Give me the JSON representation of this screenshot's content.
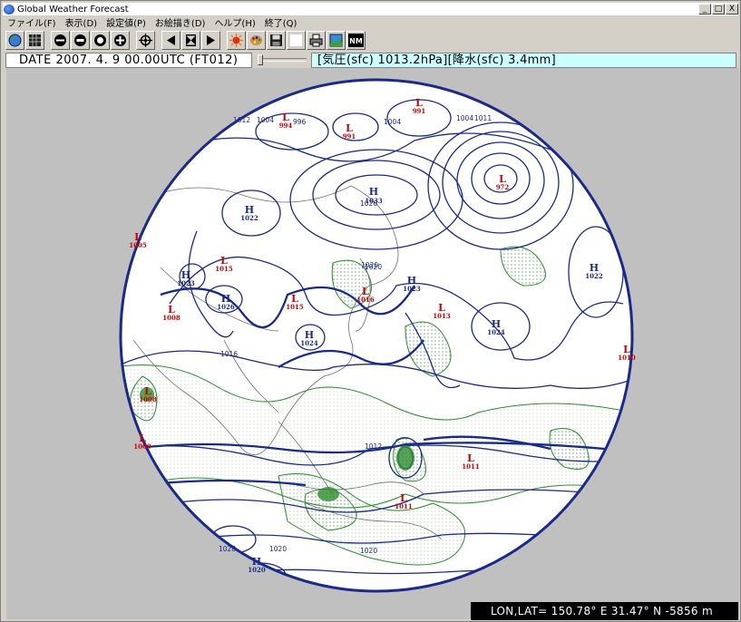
{
  "window": {
    "title": "Global Weather Forecast",
    "controls": {
      "minimize": "_",
      "maximize": "□",
      "close": "X"
    }
  },
  "menu": {
    "items": [
      "ファイル(F)",
      "表示(D)",
      "設定値(P)",
      "お絵描き(D)",
      "ヘルプ(H)",
      "終了(Q)"
    ]
  },
  "toolbar": {
    "buttons": [
      {
        "icon": "globe-icon"
      },
      {
        "icon": "grid-icon"
      },
      {
        "icon": "zoom-out-icon",
        "glyph": "−"
      },
      {
        "icon": "zoom-minus-icon",
        "glyph": "⊖"
      },
      {
        "icon": "zoom-plus-icon",
        "glyph": "⊕"
      },
      {
        "icon": "plus-icon",
        "glyph": "+"
      },
      {
        "icon": "center-icon",
        "glyph": "⌖"
      },
      {
        "icon": "step-back-icon",
        "glyph": "◀"
      },
      {
        "icon": "stop-icon",
        "glyph": "⧓"
      },
      {
        "icon": "step-forward-icon",
        "glyph": "▶"
      },
      {
        "icon": "sun-icon",
        "glyph": "☀"
      },
      {
        "icon": "palette-icon",
        "glyph": "◍"
      },
      {
        "icon": "save-icon",
        "glyph": "▣"
      },
      {
        "icon": "blank-icon",
        "glyph": ""
      },
      {
        "icon": "print-icon",
        "glyph": "⎙"
      },
      {
        "icon": "image-icon",
        "glyph": "▨"
      },
      {
        "icon": "nm-icon",
        "glyph": "NM"
      }
    ]
  },
  "info": {
    "date": "DATE 2007. 4. 9 00.00UTC (FT012)",
    "value": "[気圧(sfc) 1013.2hPa][降水(sfc) 3.4mm]"
  },
  "status": {
    "text": "LON,LAT= 150.78° E  31.47° N  -5856 m"
  },
  "map": {
    "colors": {
      "isobar": "#1a2a8a",
      "precip": "#2e8b2e",
      "coast": "#606060",
      "high": "#1a2a8a",
      "low": "#cc0000"
    },
    "highs": [
      {
        "label": "H",
        "value": "1033"
      },
      {
        "label": "H",
        "value": "1022"
      },
      {
        "label": "H",
        "value": "1023"
      },
      {
        "label": "H",
        "value": "1024"
      },
      {
        "label": "H",
        "value": "1022"
      },
      {
        "label": "H",
        "value": "1023"
      },
      {
        "label": "H",
        "value": "1026"
      },
      {
        "label": "H",
        "value": "1024"
      },
      {
        "label": "H",
        "value": "1020"
      }
    ],
    "lows": [
      {
        "label": "L",
        "value": "994"
      },
      {
        "label": "L",
        "value": "991"
      },
      {
        "label": "L",
        "value": "991"
      },
      {
        "label": "L",
        "value": "972"
      },
      {
        "label": "L",
        "value": "1015"
      },
      {
        "label": "L",
        "value": "1016"
      },
      {
        "label": "L",
        "value": "1015"
      },
      {
        "label": "L",
        "value": "1013"
      },
      {
        "label": "L",
        "value": "1005"
      },
      {
        "label": "L",
        "value": "1008"
      },
      {
        "label": "L",
        "value": "1008"
      },
      {
        "label": "L",
        "value": "1009"
      },
      {
        "label": "L",
        "value": "1011"
      },
      {
        "label": "L",
        "value": "1011"
      },
      {
        "label": "L",
        "value": "1010"
      }
    ],
    "isobar_labels": [
      "1012",
      "1004",
      "996",
      "1004",
      "1004",
      "1011",
      "1020",
      "1026",
      "1020",
      "1016",
      "1012",
      "1028",
      "1020",
      "1020"
    ]
  }
}
